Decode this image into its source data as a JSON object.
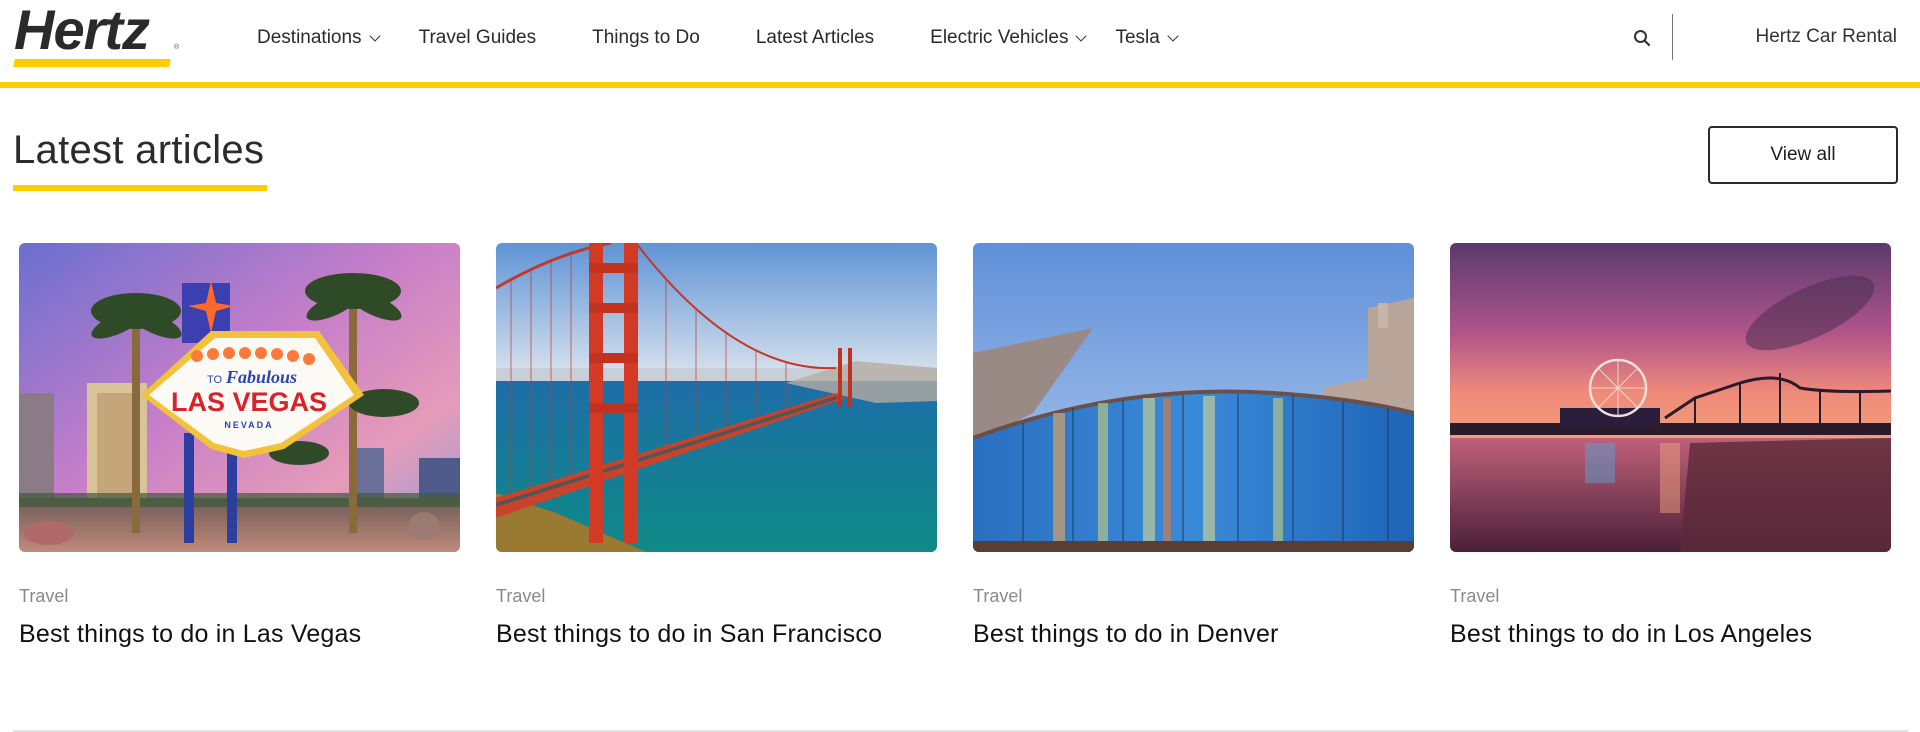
{
  "header": {
    "logo_text": "Hertz",
    "nav": [
      {
        "label": "Destinations",
        "has_dropdown": true
      },
      {
        "label": "Travel Guides",
        "has_dropdown": false
      },
      {
        "label": "Things to Do",
        "has_dropdown": false
      },
      {
        "label": "Latest Articles",
        "has_dropdown": false
      },
      {
        "label": "Electric Vehicles",
        "has_dropdown": true
      },
      {
        "label": "Tesla",
        "has_dropdown": true
      }
    ],
    "search_icon": "search-icon",
    "car_rental_link": "Hertz Car Rental"
  },
  "section": {
    "title": "Latest articles",
    "view_all_label": "View all"
  },
  "articles": [
    {
      "category": "Travel",
      "title": "Best things to do in Las Vegas",
      "image": "las-vegas-sign-image"
    },
    {
      "category": "Travel",
      "title": "Best things to do in San Francisco",
      "image": "golden-gate-bridge-image"
    },
    {
      "category": "Travel",
      "title": "Best things to do in Denver",
      "image": "denver-glass-building-image"
    },
    {
      "category": "Travel",
      "title": "Best things to do in Los Angeles",
      "image": "santa-monica-pier-image"
    }
  ],
  "colors": {
    "brand_yellow": "#ffcc00",
    "text_dark": "#2a2a2a",
    "category_gray": "#8a8a8a"
  }
}
